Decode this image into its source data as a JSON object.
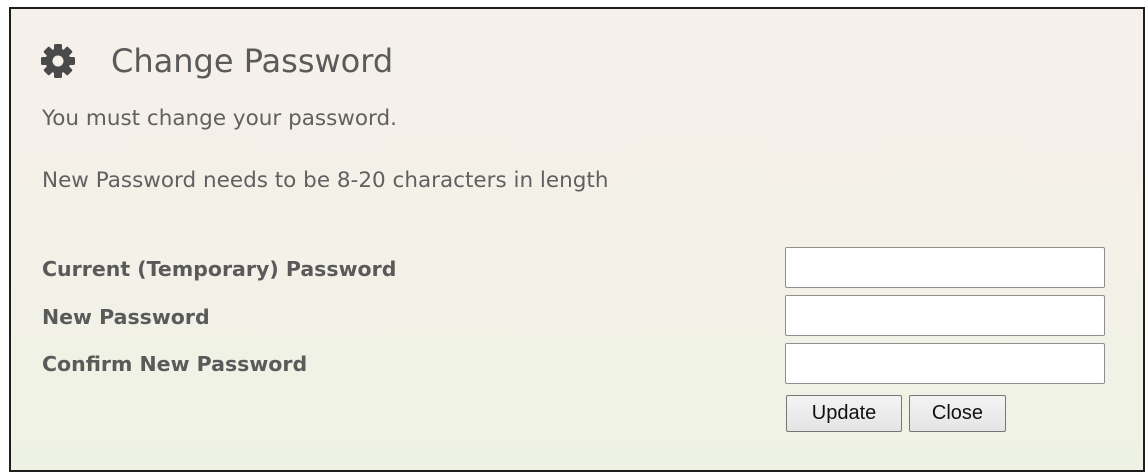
{
  "dialog": {
    "title": "Change Password",
    "icon": "gear-icon",
    "message": "You must change your password.",
    "requirement": "New Password needs to be 8-20 characters in length"
  },
  "form": {
    "current_label": "Current (Temporary) Password",
    "current_value": "",
    "new_label": "New Password",
    "new_value": "",
    "confirm_label": "Confirm New Password",
    "confirm_value": ""
  },
  "buttons": {
    "update_label": "Update",
    "close_label": "Close"
  }
}
